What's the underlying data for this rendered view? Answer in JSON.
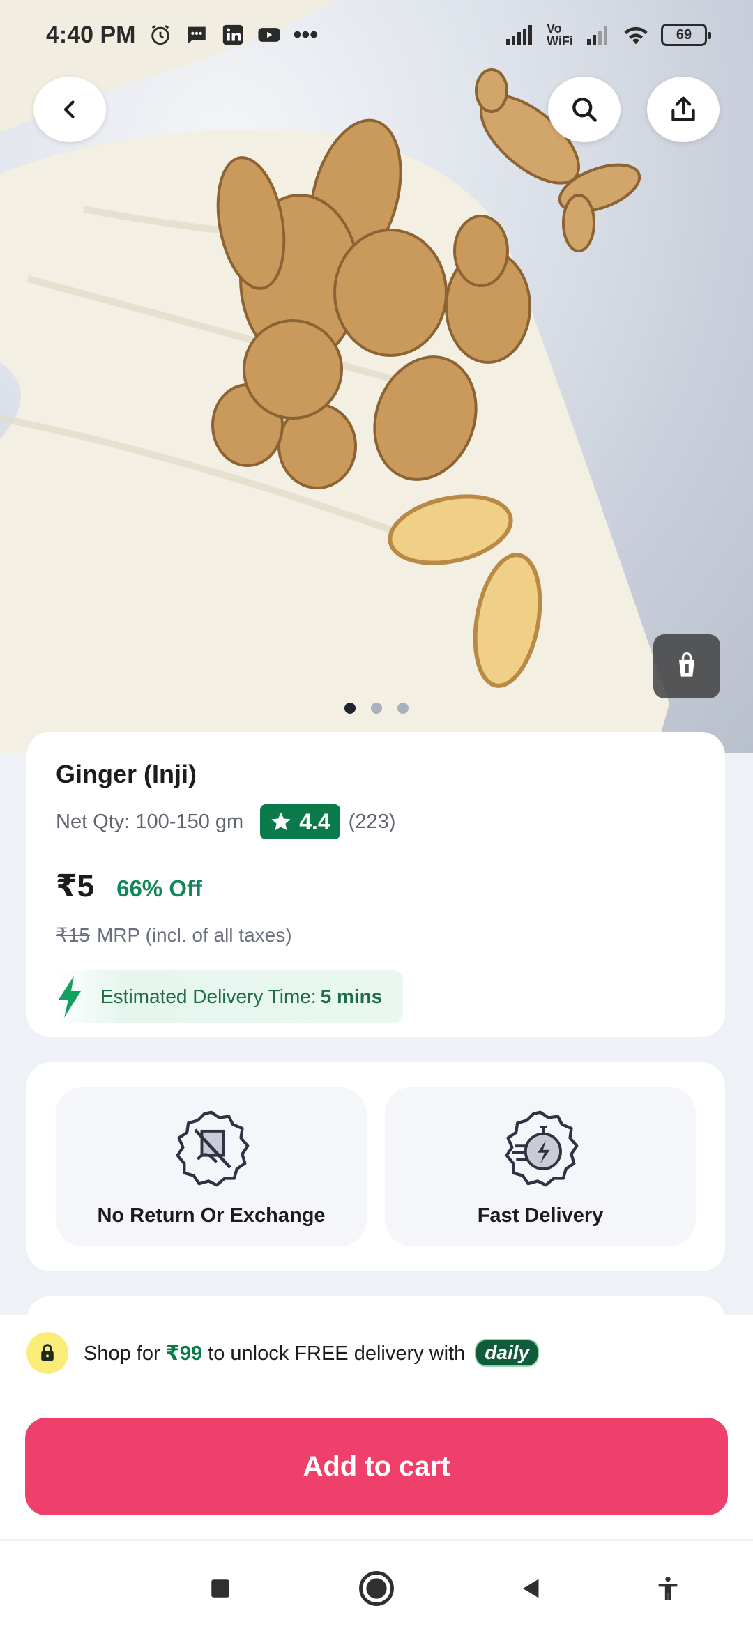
{
  "status_bar": {
    "time": "4:40 PM",
    "more": "•••",
    "vowifi": "Vo WiFi",
    "battery": "69"
  },
  "gallery": {
    "image": "ginger-product-photo",
    "page_count": 3,
    "active_page": 1
  },
  "product": {
    "name": "Ginger (Inji)",
    "net_qty": "Net Qty: 100-150 gm",
    "rating": "4.4",
    "rating_count": "(223)",
    "price": "₹5",
    "discount": "66% Off",
    "mrp_old": "₹15",
    "mrp_label": "MRP (incl. of all taxes)",
    "delivery_label": "Estimated Delivery Time:",
    "delivery_time": "5 mins"
  },
  "features": [
    {
      "label": "No Return Or Exchange",
      "icon": "no-return-icon"
    },
    {
      "label": "Fast Delivery",
      "icon": "fast-delivery-icon"
    }
  ],
  "promo": {
    "text_before": "Shop for ",
    "amount": "₹99",
    "text_after": " to unlock FREE delivery with",
    "badge": "daily"
  },
  "cart": {
    "button_label": "Add to cart"
  },
  "colors": {
    "accent_pink": "#ee406b",
    "green": "#0b7a4a",
    "discount_green": "#12865a"
  }
}
